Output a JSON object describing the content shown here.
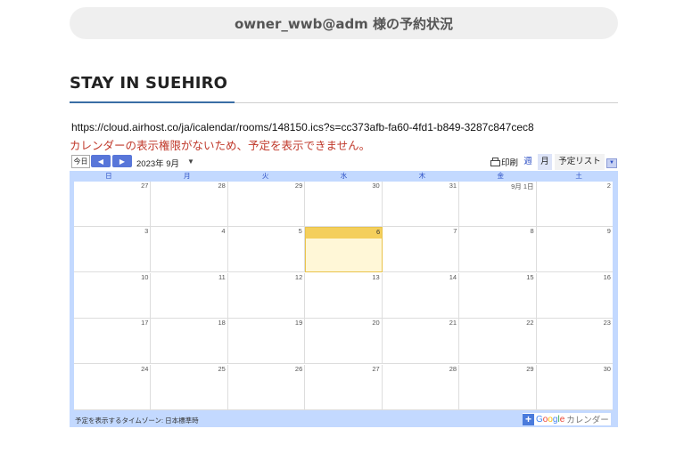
{
  "header": {
    "owner_status": "owner_wwb@adm 様の予約状況"
  },
  "section": {
    "title": "STAY IN SUEHIRO"
  },
  "calendar_feed": {
    "url": "https://cloud.airhost.co/ja/icalendar/rooms/148150.ics?s=cc373afb-fa60-4fd1-b849-3287c847cec8",
    "error": "カレンダーの表示権限がないため、予定を表示できません。"
  },
  "toolbar": {
    "today_label": "今日",
    "prev_label": "◀",
    "next_label": "▶",
    "month_label": "2023年 9月",
    "month_dropdown": "▼",
    "print_label": "印刷",
    "tab_week": "週",
    "tab_month": "月",
    "tab_agenda": "予定リスト",
    "agenda_dropdown": "▼"
  },
  "days_of_week": [
    "日",
    "月",
    "火",
    "水",
    "木",
    "金",
    "土"
  ],
  "weeks": [
    [
      "27",
      "28",
      "29",
      "30",
      "31",
      "9月 1日",
      "2"
    ],
    [
      "3",
      "4",
      "5",
      "6",
      "7",
      "8",
      "9"
    ],
    [
      "10",
      "11",
      "12",
      "13",
      "14",
      "15",
      "16"
    ],
    [
      "17",
      "18",
      "19",
      "20",
      "21",
      "22",
      "23"
    ],
    [
      "24",
      "25",
      "26",
      "27",
      "28",
      "29",
      "30"
    ]
  ],
  "today": {
    "week": 1,
    "day": 3
  },
  "footer": {
    "timezone": "予定を表示するタイムゾーン: 日本標準時",
    "gcal_plus": "+",
    "gcal_word": [
      "G",
      "o",
      "o",
      "g",
      "l",
      "e"
    ],
    "gcal_suffix": "カレンダー"
  },
  "colors": {
    "accent": "#3a6ea5",
    "error": "#c0392b",
    "today_head": "#f4cf5c",
    "today_bg": "#fff7d7",
    "grid_frame": "#c3d9ff",
    "nav_button": "#5876d9"
  }
}
